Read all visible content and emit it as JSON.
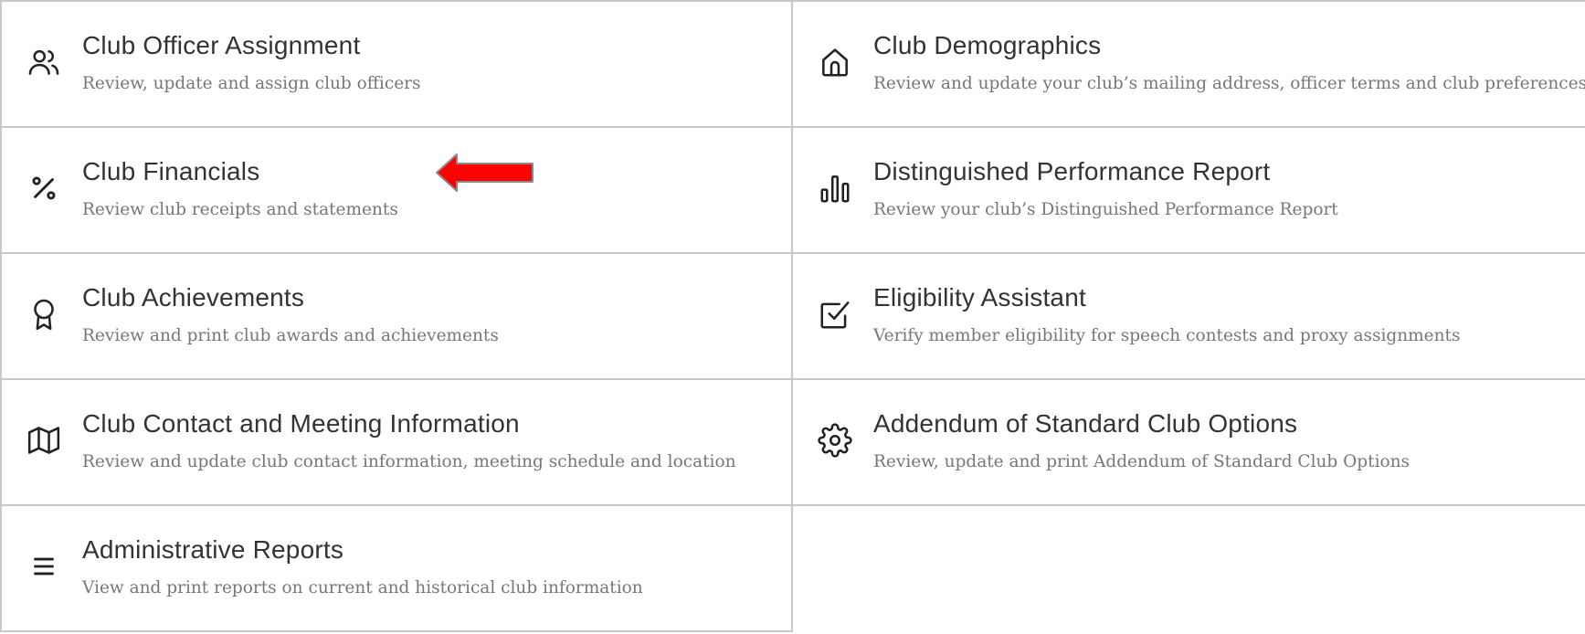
{
  "cards": [
    {
      "title": "Club Officer Assignment",
      "description": "Review, update and assign club officers",
      "icon": "users-icon"
    },
    {
      "title": "Club Demographics",
      "description": "Review and update your club’s mailing address, officer terms and club preferences",
      "icon": "home-icon"
    },
    {
      "title": "Club Financials",
      "description": "Review club receipts and statements",
      "icon": "percent-icon"
    },
    {
      "title": "Distinguished Performance Report",
      "description": "Review your club’s Distinguished Performance Report",
      "icon": "bar-chart-icon"
    },
    {
      "title": "Club Achievements",
      "description": "Review and print club awards and achievements",
      "icon": "award-icon"
    },
    {
      "title": "Eligibility Assistant",
      "description": "Verify member eligibility for speech contests and proxy assignments",
      "icon": "check-square-icon"
    },
    {
      "title": "Club Contact and Meeting Information",
      "description": "Review and update club contact information, meeting schedule and location",
      "icon": "map-icon"
    },
    {
      "title": "Addendum of Standard Club Options",
      "description": "Review, update and print Addendum of Standard Club Options",
      "icon": "gear-icon"
    },
    {
      "title": "Administrative Reports",
      "description": "View and print reports on current and historical club information",
      "icon": "menu-icon"
    }
  ],
  "colors": {
    "border": "#c9c9c9",
    "title": "#333333",
    "description": "#777777",
    "annotation_arrow": "#ff0000"
  },
  "annotation": {
    "icon": "red-arrow-icon",
    "points_to": "Club Financials"
  }
}
